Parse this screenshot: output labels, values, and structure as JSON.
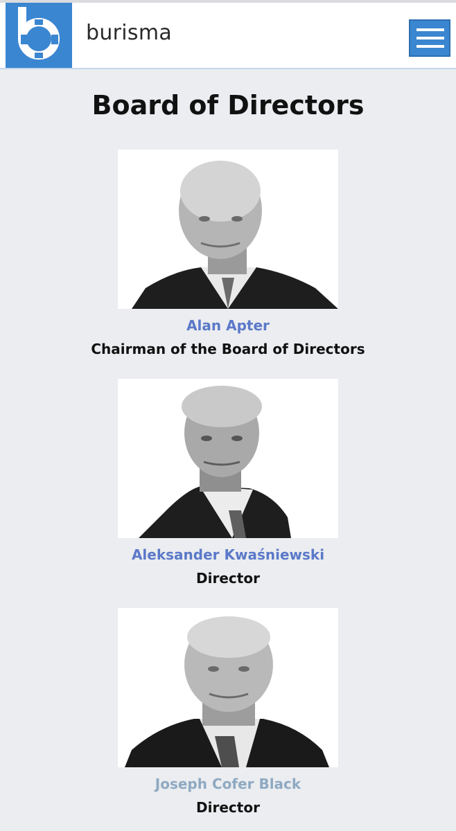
{
  "header": {
    "brand_name": "burisma",
    "logo_icon": "burisma-b-logo-icon",
    "menu_icon": "hamburger-menu-icon",
    "accent_color": "#3b86d0"
  },
  "page": {
    "title": "Board of Directors"
  },
  "directors": [
    {
      "name": "Alan Apter",
      "role": "Chairman of the Board of Directors",
      "photo": "portrait-photo"
    },
    {
      "name": "Aleksander Kwaśniewski",
      "role": "Director",
      "photo": "portrait-photo"
    },
    {
      "name": "Joseph Cofer Black",
      "role": "Director",
      "photo": "portrait-photo"
    }
  ],
  "colors": {
    "link": "#5b79c9",
    "visited_link": "#8fa9c2",
    "background": "#ebedf0"
  }
}
